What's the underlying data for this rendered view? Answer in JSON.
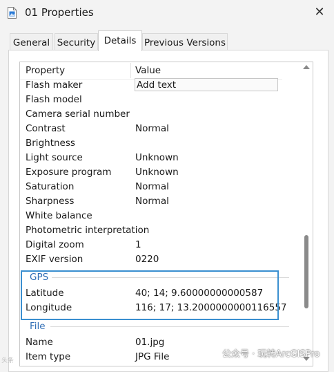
{
  "window": {
    "title": "01 Properties",
    "close_glyph": "✕"
  },
  "tabs": [
    {
      "label": "General",
      "active": false
    },
    {
      "label": "Security",
      "active": false
    },
    {
      "label": "Details",
      "active": true
    },
    {
      "label": "Previous Versions",
      "active": false
    }
  ],
  "details": {
    "header": {
      "property": "Property",
      "value": "Value"
    },
    "rows": [
      {
        "property": "Flash maker",
        "value": "Add text",
        "editable": true
      },
      {
        "property": "Flash model",
        "value": ""
      },
      {
        "property": "Camera serial number",
        "value": ""
      },
      {
        "property": "Contrast",
        "value": "Normal"
      },
      {
        "property": "Brightness",
        "value": ""
      },
      {
        "property": "Light source",
        "value": "Unknown"
      },
      {
        "property": "Exposure program",
        "value": "Unknown"
      },
      {
        "property": "Saturation",
        "value": "Normal"
      },
      {
        "property": "Sharpness",
        "value": "Normal"
      },
      {
        "property": "White balance",
        "value": ""
      },
      {
        "property": "Photometric interpretation",
        "value": ""
      },
      {
        "property": "Digital zoom",
        "value": "1"
      },
      {
        "property": "EXIF version",
        "value": "0220"
      }
    ],
    "gps_group": {
      "label": "GPS",
      "rows": [
        {
          "property": "Latitude",
          "value": "40; 14; 9.60000000000587"
        },
        {
          "property": "Longitude",
          "value": "116; 17; 13.2000000000116557"
        }
      ]
    },
    "file_group": {
      "label": "File",
      "rows": [
        {
          "property": "Name",
          "value": "01.jpg"
        },
        {
          "property": "Item type",
          "value": "JPG File"
        }
      ]
    }
  },
  "overlay": {
    "highlight_color": "#3a8fd0",
    "watermark": "公众号 · 玩转ArcGISPro",
    "watermark_left": "头条"
  },
  "colors": {
    "accent": "#2f6db5",
    "background": "#f3f3f3"
  }
}
